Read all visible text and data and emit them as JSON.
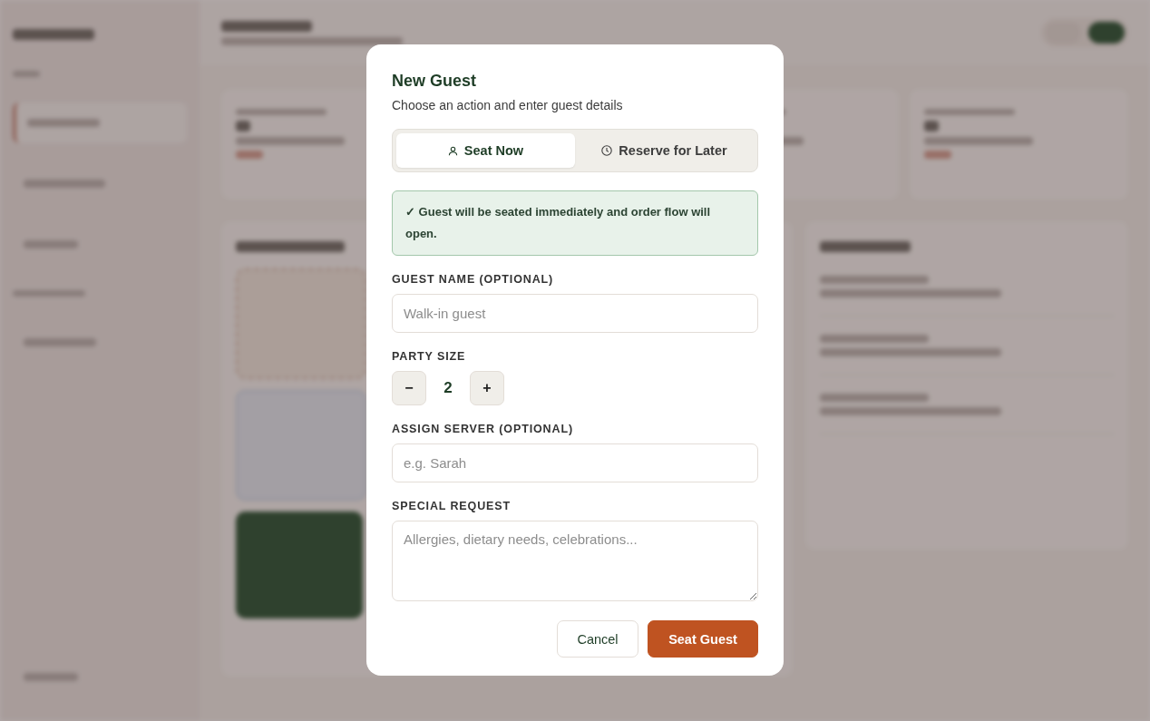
{
  "dialog": {
    "title": "New Guest",
    "subtitle": "Choose an action and enter guest details",
    "modes": [
      {
        "label": "Seat Now",
        "kind": "now",
        "selected": true
      },
      {
        "label": "Reserve for Later",
        "kind": "later",
        "selected": false
      }
    ],
    "notice": "✓ Guest will be seated immediately and order flow will open.",
    "fields": [
      {
        "kind": "text",
        "label": "GUEST NAME (OPTIONAL)",
        "placeholder": "Walk-in guest"
      },
      {
        "kind": "stepper",
        "label": "PARTY SIZE",
        "value": "2",
        "decrement": "−",
        "increment": "+"
      },
      {
        "kind": "text",
        "label": "ASSIGN SERVER (OPTIONAL)",
        "placeholder": "e.g. Sarah"
      },
      {
        "kind": "textarea",
        "label": "SPECIAL REQUEST",
        "placeholder": "Allergies, dietary needs, celebrations..."
      }
    ],
    "buttons": [
      {
        "kind": "secondary",
        "label": "Cancel"
      },
      {
        "kind": "primary",
        "label": "Seat Guest"
      }
    ]
  }
}
